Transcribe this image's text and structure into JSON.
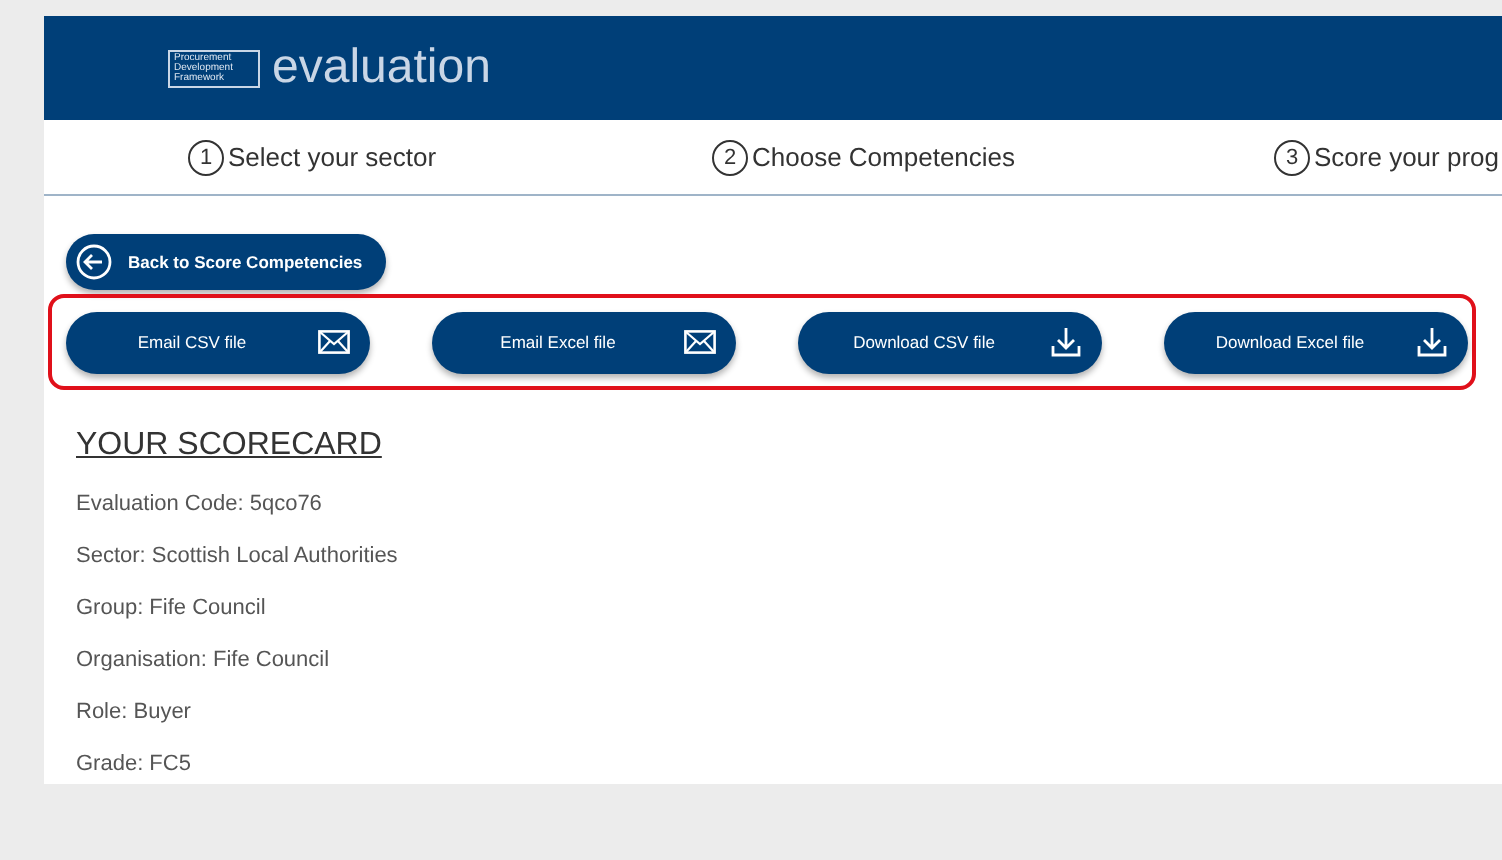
{
  "header": {
    "logo_text": "Procurement Development Framework",
    "title": "evaluation"
  },
  "steps": [
    {
      "number": "1",
      "label": "Select your sector"
    },
    {
      "number": "2",
      "label": "Choose Competencies"
    },
    {
      "number": "3",
      "label": "Score your prog"
    }
  ],
  "back_button": {
    "label": "Back to Score Competencies"
  },
  "export_buttons": [
    {
      "label": "Email CSV file",
      "kind": "email"
    },
    {
      "label": "Email Excel file",
      "kind": "email"
    },
    {
      "label": "Download CSV file",
      "kind": "download"
    },
    {
      "label": "Download Excel file",
      "kind": "download"
    }
  ],
  "scorecard": {
    "heading": "YOUR SCORECARD",
    "lines": [
      "Evaluation Code: 5qco76",
      "Sector: Scottish Local Authorities",
      "Group: Fife Council",
      "Organisation: Fife Council",
      "Role: Buyer",
      "Grade: FC5"
    ]
  }
}
